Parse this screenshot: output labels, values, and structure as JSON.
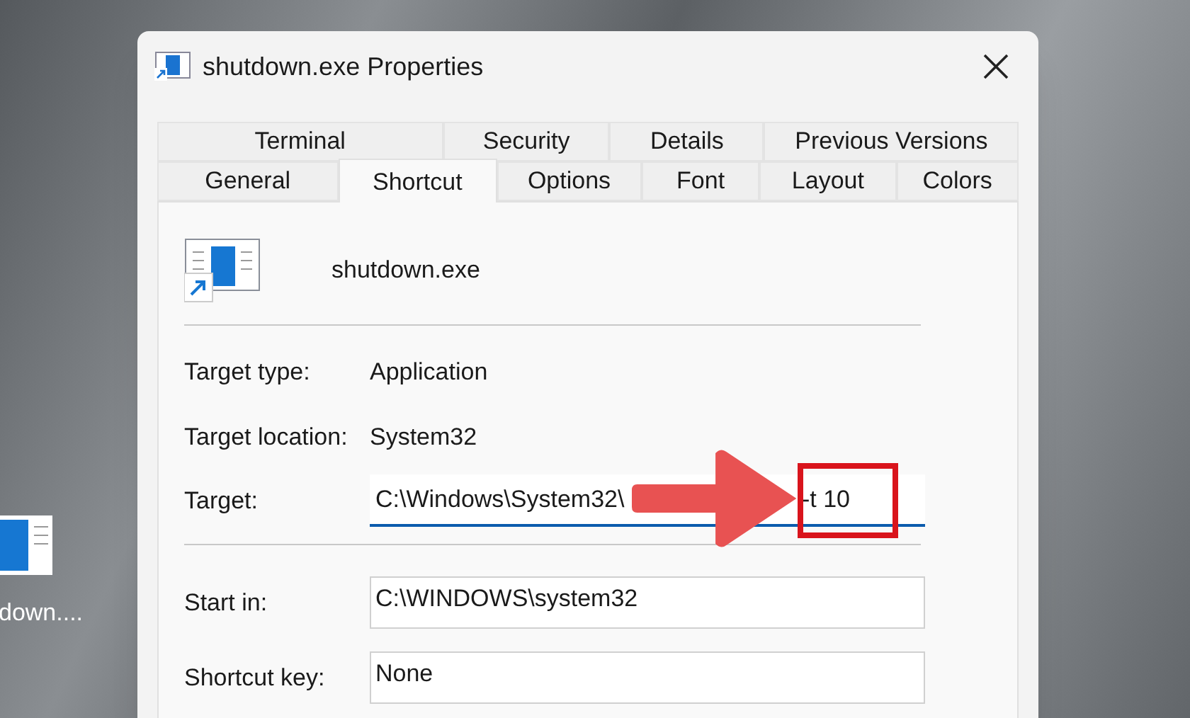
{
  "desktop": {
    "icons": [
      {
        "label": "down...."
      }
    ]
  },
  "window": {
    "title": "shutdown.exe Properties"
  },
  "tabs": [
    [
      {
        "label": "Terminal",
        "selected": false
      },
      {
        "label": "Security",
        "selected": false
      },
      {
        "label": "Details",
        "selected": false
      },
      {
        "label": "Previous Versions",
        "selected": false
      }
    ],
    [
      {
        "label": "General",
        "selected": false
      },
      {
        "label": "Shortcut",
        "selected": true
      },
      {
        "label": "Options",
        "selected": false
      },
      {
        "label": "Font",
        "selected": false
      },
      {
        "label": "Layout",
        "selected": false
      },
      {
        "label": "Colors",
        "selected": false
      }
    ]
  ],
  "file_name": "shutdown.exe",
  "info": [
    {
      "label": "Target type:",
      "value": "Application"
    },
    {
      "label": "Target location:",
      "value": "System32"
    }
  ],
  "target": {
    "label": "Target:",
    "value_start": "C:\\Windows\\System32\\",
    "value_end": "-t 10"
  },
  "fields": [
    {
      "label": "Start in:",
      "value": "C:\\WINDOWS\\system32"
    },
    {
      "label": "Shortcut key:",
      "value": "None"
    }
  ]
}
